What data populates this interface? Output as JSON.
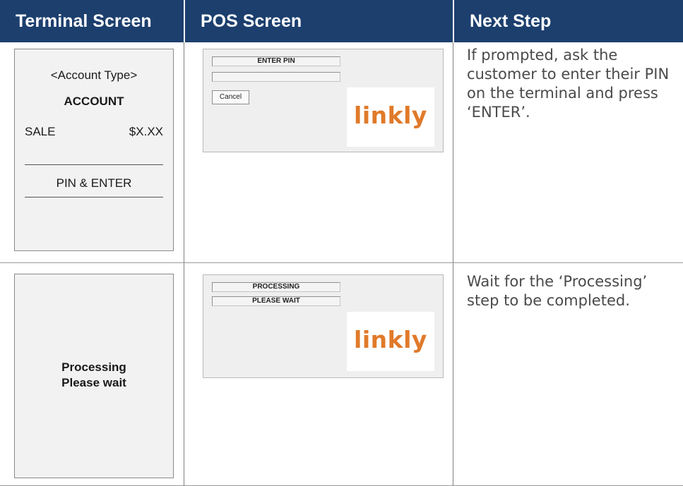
{
  "headers": {
    "terminal": "Terminal Screen",
    "pos": "POS Screen",
    "next": "Next Step"
  },
  "rows": [
    {
      "terminal": {
        "account_type": "<Account Type>",
        "account": "ACCOUNT",
        "sale_label": "SALE",
        "sale_amount": "$X.XX",
        "prompt": "PIN & ENTER"
      },
      "pos": {
        "field1": "ENTER PIN",
        "field2": "",
        "button": "Cancel",
        "logo": "linkly"
      },
      "next_step": "If prompted, ask the customer to enter their PIN on the terminal and press ‘ENTER’."
    },
    {
      "terminal": {
        "line1": "Processing",
        "line2": "Please wait"
      },
      "pos": {
        "field1": "PROCESSING",
        "field2": "PLEASE WAIT",
        "logo": "linkly"
      },
      "next_step": "Wait for the ‘Processing’ step to be completed."
    }
  ],
  "colors": {
    "header_bg": "#1c3f6e",
    "header_text": "#ffffff",
    "logo_orange": "#e07a2a"
  }
}
